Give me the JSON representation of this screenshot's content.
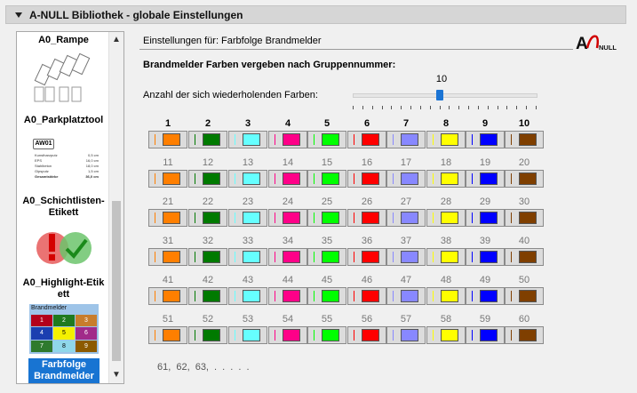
{
  "panel": {
    "title": "A-NULL Bibliothek - globale Einstellungen"
  },
  "sidebar": {
    "items": [
      {
        "label": "A0_Rampe"
      },
      {
        "label": "A0_Parkplatztool"
      },
      {
        "label": "A0_Schichtlisten-Etikett",
        "line1": "A0_Schichtlisten-",
        "line2": "Etikett"
      },
      {
        "label": "A0_Highlight-Etikett",
        "line1": "A0_Highlight-Etik",
        "line2": "ett"
      },
      {
        "label": "Farbfolge Brandmelder",
        "line1": "Farbfolge",
        "line2": "Brandmelder",
        "selected": true
      }
    ],
    "schicht_thumb": {
      "code": "AW01",
      "rows": [
        [
          "Kunstharzputz",
          "0,5 cm"
        ],
        [
          "EPS",
          "16,0 cm"
        ],
        [
          "Stahlbeton",
          "18,0 cm"
        ],
        [
          "Gipsputz",
          "1,5 cm"
        ],
        [
          "Gesamtstärke",
          "36,0 cm"
        ]
      ]
    },
    "brandmelder_thumb": {
      "title": "Brandmelder",
      "cells": [
        "1",
        "2",
        "3",
        "4",
        "5",
        "6",
        "7",
        "8",
        "9"
      ],
      "colors": [
        "#b3001b",
        "#1f7a1f",
        "#c87d2c",
        "#1b3fb0",
        "#f4f000",
        "#a12a8a",
        "#2e7a2e",
        "#8fd7ea",
        "#8c5a00"
      ]
    },
    "scroll_up": "▲",
    "scroll_down": "▼"
  },
  "main": {
    "settings_for": "Einstellungen für: Farbfolge Brandmelder",
    "logo": {
      "a": "A",
      "null": "NULL"
    },
    "heading": "Brandmelder Farben vergeben nach Gruppennummer:",
    "slider": {
      "caption": "Anzahl der sich wiederholenden Farben:",
      "value": "10",
      "min": 1,
      "max": 20,
      "current": 10
    },
    "colors": [
      "#ff7f00",
      "#007a00",
      "#66ffff",
      "#ff0088",
      "#00ff00",
      "#ff0000",
      "#8888ff",
      "#ffff00",
      "#0000ff",
      "#7f3f00"
    ],
    "grid_rows": [
      [
        "1",
        "2",
        "3",
        "4",
        "5",
        "6",
        "7",
        "8",
        "9",
        "10"
      ],
      [
        "11",
        "12",
        "13",
        "14",
        "15",
        "16",
        "17",
        "18",
        "19",
        "20"
      ],
      [
        "21",
        "22",
        "23",
        "24",
        "25",
        "26",
        "27",
        "28",
        "29",
        "30"
      ],
      [
        "31",
        "32",
        "33",
        "34",
        "35",
        "36",
        "37",
        "38",
        "39",
        "40"
      ],
      [
        "41",
        "42",
        "43",
        "44",
        "45",
        "46",
        "47",
        "48",
        "49",
        "50"
      ],
      [
        "51",
        "52",
        "53",
        "54",
        "55",
        "56",
        "57",
        "58",
        "59",
        "60"
      ]
    ],
    "more_text": "61,   62,   63,   . . . . ."
  }
}
